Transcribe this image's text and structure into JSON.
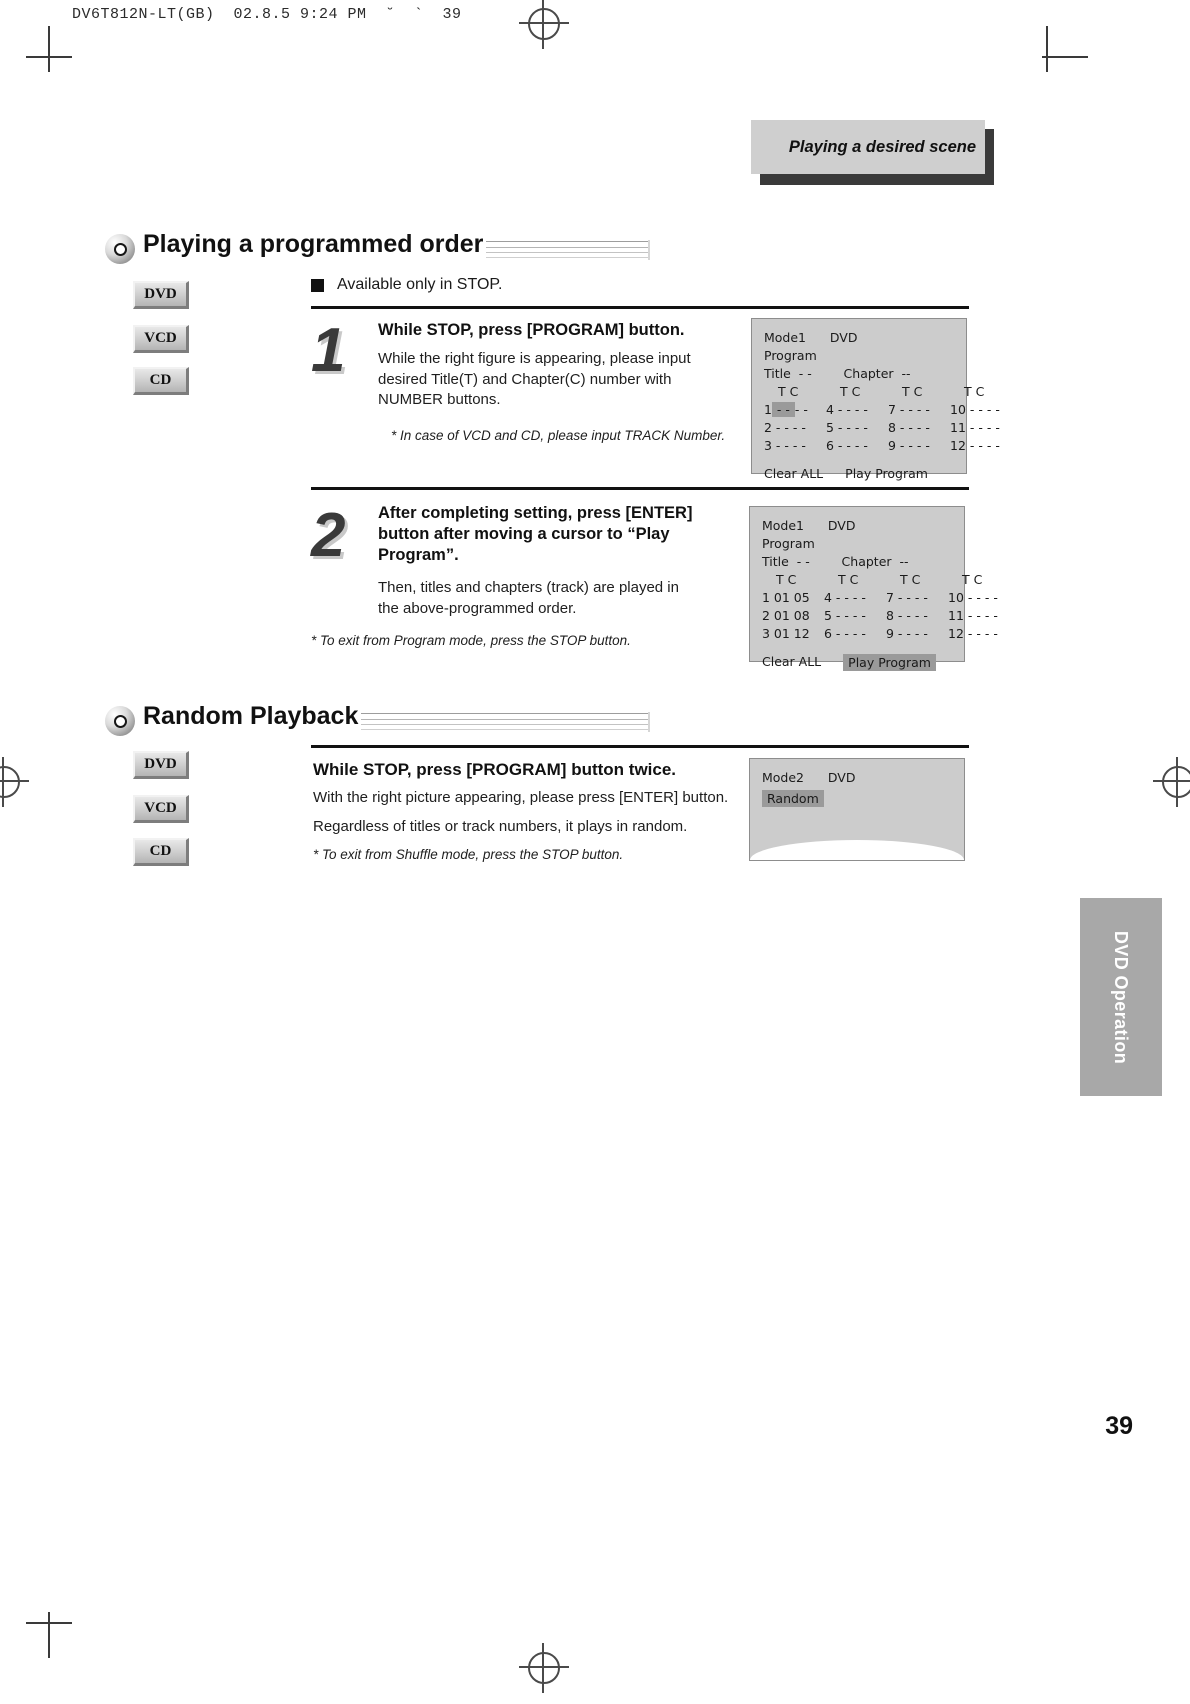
{
  "print_header": "DV6T812N-LT(GB)  02.8.5 9:24 PM  ˘  `  39",
  "banner": {
    "title": "Playing a desired scene"
  },
  "page_number": "39",
  "side_tab": {
    "label": "DVD Operation"
  },
  "section1": {
    "title": "Playing a programmed order",
    "badges": [
      "DVD",
      "VCD",
      "CD"
    ],
    "note_bullet": "Available only in STOP.",
    "steps": [
      {
        "number": "1",
        "title": "While STOP, press [PROGRAM] button.",
        "body": "While the right figure is appearing, please input desired Title(T) and Chapter(C) number with NUMBER buttons.",
        "note": "* In case of VCD and CD, please input TRACK Number."
      },
      {
        "number": "2",
        "title": "After completing setting, press [ENTER] button after moving a cursor to “Play Program”.",
        "body": "Then, titles and chapters (track) are played in the above-programmed order.",
        "note": "* To exit from Program mode, press the STOP button."
      }
    ],
    "osd1": {
      "mode": "Mode1",
      "disc": "DVD",
      "program_label": "Program",
      "title_label": "Title",
      "title_value": "- -",
      "chapter_label": "Chapter",
      "chapter_value": "--",
      "col_headers": [
        "T C",
        "T C",
        "T C",
        "T C"
      ],
      "rows": [
        [
          "1",
          "- -",
          "- -",
          "4",
          "- - - -",
          "7",
          "- - - -",
          "10",
          "- - - -"
        ],
        [
          "2",
          "- - - -",
          "",
          "5",
          "- - - -",
          "8",
          "- - - -",
          "11",
          "- - - -"
        ],
        [
          "3",
          "- - - -",
          "",
          "6",
          "- - - -",
          "9",
          "- - - -",
          "12",
          "- - - -"
        ]
      ],
      "highlight_cell": "1",
      "clear_all": "Clear ALL",
      "play_program": "Play Program",
      "selected_button": ""
    },
    "osd2": {
      "mode": "Mode1",
      "disc": "DVD",
      "program_label": "Program",
      "title_label": "Title",
      "title_value": "- -",
      "chapter_label": "Chapter",
      "chapter_value": "--",
      "col_headers": [
        "T C",
        "T C",
        "T C",
        "T C"
      ],
      "rows": [
        [
          "1",
          "01 05",
          "",
          "4",
          "- - - -",
          "7",
          "- - - -",
          "10",
          "- - - -"
        ],
        [
          "2",
          "01 08",
          "",
          "5",
          "- - - -",
          "8",
          "- - - -",
          "11",
          "- - - -"
        ],
        [
          "3",
          "01 12",
          "",
          "6",
          "- - - -",
          "9",
          "- - - -",
          "12",
          "- - - -"
        ]
      ],
      "clear_all": "Clear ALL",
      "play_program": "Play Program",
      "selected_button": "Play Program"
    }
  },
  "section2": {
    "title": "Random Playback",
    "badges": [
      "DVD",
      "VCD",
      "CD"
    ],
    "heading": "While STOP,  press [PROGRAM] button twice.",
    "body1": "With the right picture appearing, please press [ENTER] button.",
    "body2": "Regardless of titles or track numbers, it plays in random.",
    "note": "* To exit from Shuffle mode, press the STOP button.",
    "osd": {
      "mode": "Mode2",
      "disc": "DVD",
      "random_label": "Random"
    }
  }
}
